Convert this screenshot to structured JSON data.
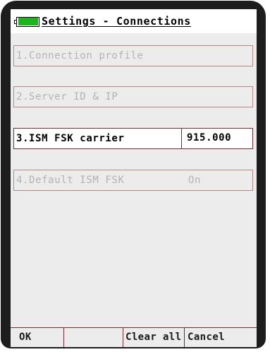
{
  "title": "Settings - Connections",
  "menu": [
    {
      "label": "1.Connection profile",
      "value": "",
      "state": "disabled"
    },
    {
      "label": "2.Server ID & IP",
      "value": "",
      "state": "disabled"
    },
    {
      "label": "3.ISM FSK carrier",
      "value": "915.000",
      "state": "selected"
    },
    {
      "label": "4.Default ISM FSK",
      "value": "On",
      "state": "disabled"
    }
  ],
  "softkeys": {
    "left": "OK",
    "middle_left": "",
    "middle_right": "Clear all",
    "right": "Cancel"
  },
  "colors": {
    "battery_fill": "#1eb41e",
    "row_border": "#b9868a",
    "active_border": "#7a2a30",
    "disabled_text": "#b3b3b3"
  },
  "icons": {
    "battery": "battery-icon"
  }
}
